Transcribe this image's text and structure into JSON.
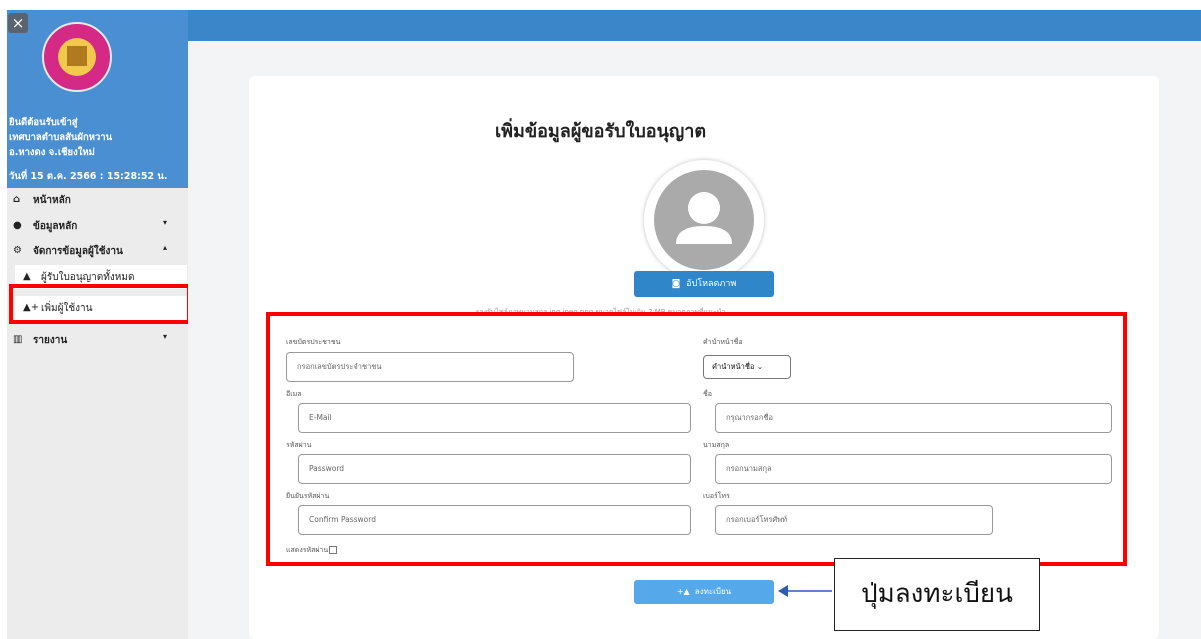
{
  "sidebar": {
    "close_glyph": "×",
    "welcome_lines": [
      "ยินดีต้อนรับเข้าสู่",
      "เทศบาลตำบลสันผักหวาน",
      "อ.หางดง จ.เชียงใหม่"
    ],
    "datetime": "วันที่ 15 ต.ค. 2566 : 15:28:52 น.",
    "menu": {
      "home": "หน้าหลัก",
      "master_data": "ข้อมูลหลัก",
      "user_mgmt": "จัดการข้อมูลผู้ใช้งาน",
      "all_licensees": "ผู้รับใบอนุญาตทั้งหมด",
      "add_user": "เพิ่มผู้ใช้งาน",
      "report": "รายงาน"
    },
    "icons": {
      "home": "home-icon",
      "master_data": "database-icon",
      "user_mgmt": "users-cog-icon",
      "all_licensees": "user-icon",
      "add_user": "user-plus-icon",
      "report": "chart-icon"
    }
  },
  "form": {
    "title": "เพิ่มข้อมูลผู้ขอรับใบอนุญาต",
    "upload_label": "อัปโหลดภาพ",
    "note": "รองรับไฟล์ภาพนามสกุล jpg jpeg png ขนาดไฟล์ไม่เกิน 2 MB ขนาดภาพที่แนะนำ",
    "fields": {
      "id_card": {
        "label": "เลขบัตรประชาชน",
        "placeholder": "กรอกเลขบัตรประจำชาชน"
      },
      "prefix": {
        "label": "คำนำหน้าชื่อ",
        "value": "คำนำหน้าชื่อ"
      },
      "email": {
        "label": "อีเมล",
        "placeholder": "E-Mail"
      },
      "first_name": {
        "label": "ชื่อ",
        "placeholder": "กรุณากรอกชื่อ"
      },
      "password": {
        "label": "รหัสผ่าน",
        "placeholder": "Password"
      },
      "last_name": {
        "label": "นามสกุล",
        "placeholder": "กรอกนามสกุล"
      },
      "confirm_password": {
        "label": "ยืนยันรหัสผ่าน",
        "placeholder": "Confirm Password"
      },
      "phone": {
        "label": "เบอร์โทร",
        "placeholder": "กรอกเบอร์โทรศัพท์"
      }
    },
    "show_password_label": "แสดงรหัสผ่าน",
    "register_label": "ลงทะเบียน"
  },
  "annotation": {
    "callout_text": "ปุ่มลงทะเบียน",
    "highlight_color": "#ff0000",
    "arrow_color": "#2a5fb0"
  },
  "colors": {
    "sidebar_head": "#4a8fd1",
    "topbar": "#3a86c8",
    "button": "#2f86c9"
  }
}
